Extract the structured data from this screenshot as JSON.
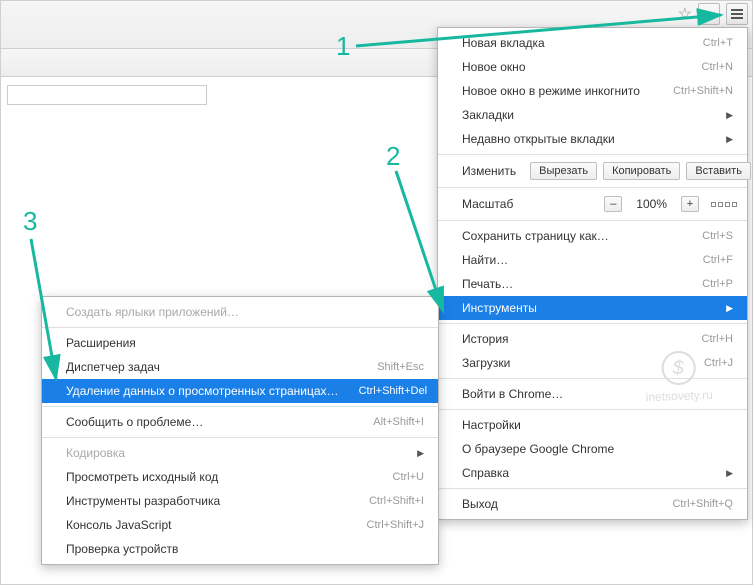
{
  "annotations": {
    "n1": "1",
    "n2": "2",
    "n3": "3"
  },
  "watermark": {
    "symbol": "$",
    "text": "inetsovety.ru"
  },
  "mainMenu": {
    "newTab": {
      "label": "Новая вкладка",
      "shortcut": "Ctrl+T"
    },
    "newWindow": {
      "label": "Новое окно",
      "shortcut": "Ctrl+N"
    },
    "incognito": {
      "label": "Новое окно в режиме инкогнито",
      "shortcut": "Ctrl+Shift+N"
    },
    "bookmarks": {
      "label": "Закладки"
    },
    "recentTabs": {
      "label": "Недавно открытые вкладки"
    },
    "editRow": {
      "label": "Изменить",
      "cut": "Вырезать",
      "copy": "Копировать",
      "paste": "Вставить"
    },
    "zoomRow": {
      "label": "Масштаб",
      "minus": "–",
      "value": "100%",
      "plus": "+"
    },
    "savePage": {
      "label": "Сохранить страницу как…",
      "shortcut": "Ctrl+S"
    },
    "find": {
      "label": "Найти…",
      "shortcut": "Ctrl+F"
    },
    "print": {
      "label": "Печать…",
      "shortcut": "Ctrl+P"
    },
    "tools": {
      "label": "Инструменты"
    },
    "history": {
      "label": "История",
      "shortcut": "Ctrl+H"
    },
    "downloads": {
      "label": "Загрузки",
      "shortcut": "Ctrl+J"
    },
    "signIn": {
      "label": "Войти в Chrome…"
    },
    "settings": {
      "label": "Настройки"
    },
    "about": {
      "label": "О браузере Google Chrome"
    },
    "help": {
      "label": "Справка"
    },
    "exit": {
      "label": "Выход",
      "shortcut": "Ctrl+Shift+Q"
    }
  },
  "subMenu": {
    "createShortcuts": {
      "label": "Создать ярлыки приложений…"
    },
    "extensions": {
      "label": "Расширения"
    },
    "taskManager": {
      "label": "Диспетчер задач",
      "shortcut": "Shift+Esc"
    },
    "clearData": {
      "label": "Удаление данных о просмотренных страницах…",
      "shortcut": "Ctrl+Shift+Del"
    },
    "reportIssue": {
      "label": "Сообщить о проблеме…",
      "shortcut": "Alt+Shift+I"
    },
    "encoding": {
      "label": "Кодировка"
    },
    "viewSource": {
      "label": "Просмотреть исходный код",
      "shortcut": "Ctrl+U"
    },
    "devTools": {
      "label": "Инструменты разработчика",
      "shortcut": "Ctrl+Shift+I"
    },
    "jsConsole": {
      "label": "Консоль JavaScript",
      "shortcut": "Ctrl+Shift+J"
    },
    "inspectDevices": {
      "label": "Проверка устройств"
    }
  }
}
